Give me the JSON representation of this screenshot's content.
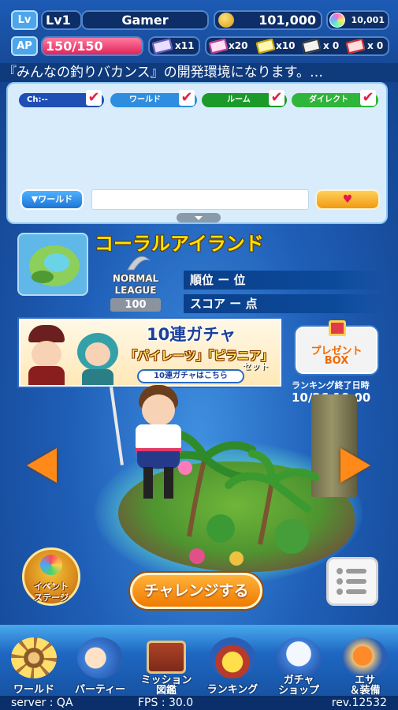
{
  "status": {
    "lv_tag": "Lv",
    "level": "Lv1",
    "player_name": "Gamer",
    "coins": "101,000",
    "gems": "10,001",
    "ap_tag": "AP",
    "ap_value": "150/150",
    "ap_fraction": 1.0,
    "tickets": [
      "x11",
      "x20",
      "x10",
      "x 0",
      "x 0"
    ]
  },
  "ticker": "『みんなの釣りバカンス』の開発環境になります。…",
  "chat": {
    "tabs": [
      {
        "label": "Ch:--",
        "color": "#1f4fb5"
      },
      {
        "label": "ワールド",
        "color": "#2f8de0"
      },
      {
        "label": "ルーム",
        "color": "#1b9a2a"
      },
      {
        "label": "ダイレクト",
        "color": "#2fb53a"
      }
    ],
    "checkmark": "✔",
    "channel_button": "▼ワールド",
    "input_placeholder": "",
    "send_icon": "♥"
  },
  "stage": {
    "title": "コーラルアイランド",
    "league_line1": "NORMAL",
    "league_line2": "LEAGUE",
    "league_number": "100",
    "rank_label": "順位 ー 位",
    "score_label": "スコア ー 点"
  },
  "gacha": {
    "title": "10連ガチャ",
    "subtitle": "「パイレーツ」「ピラニア」",
    "set_label": "セット",
    "link": "10連ガチャはこちら"
  },
  "present": {
    "line1": "プレゼント",
    "line2": "BOX"
  },
  "ranking": {
    "label": "ランキング終了日時",
    "date": "10/26 10:00"
  },
  "event_button": {
    "line1": "イベント",
    "line2": "ステージ"
  },
  "challenge_button": "チャレンジする",
  "nav": [
    {
      "label": "ワールド",
      "icon": "ship-wheel-icon"
    },
    {
      "label": "パーティー",
      "icon": "handshake-icon"
    },
    {
      "label": "ミッション\n図鑑",
      "icon": "book-icon"
    },
    {
      "label": "ランキング",
      "icon": "crown-icon"
    },
    {
      "label": "ガチャ\nショップ",
      "icon": "gacha-machine-icon"
    },
    {
      "label": "エサ\n＆装備",
      "icon": "equipment-icon"
    }
  ],
  "footer": {
    "server": "server : QA",
    "fps": "FPS : 30.0",
    "rev": "rev.12532"
  }
}
